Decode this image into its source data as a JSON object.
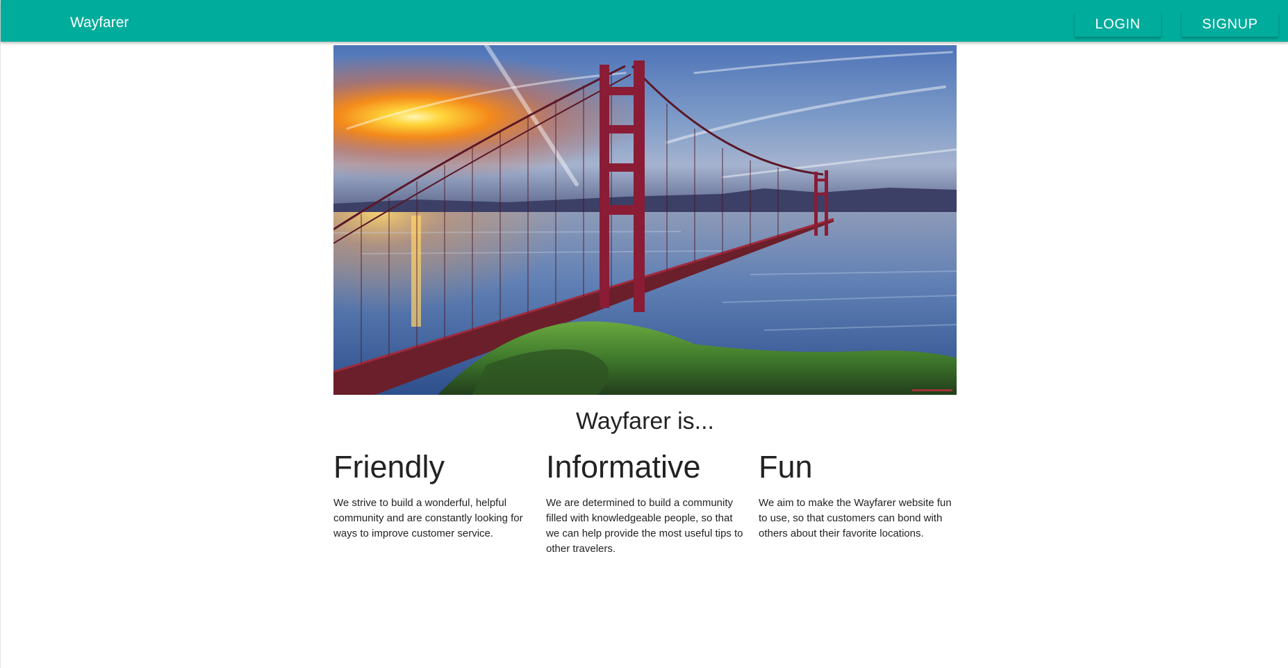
{
  "navbar": {
    "brand": "Wayfarer",
    "login_label": "LOGIN",
    "signup_label": "SIGNUP",
    "color": "#00ac9b"
  },
  "hero": {
    "image_subject": "Golden Gate Bridge at sunset"
  },
  "tagline": "Wayfarer is...",
  "features": [
    {
      "title": "Friendly",
      "text": "We strive to build a wonderful, helpful community and are constantly looking for ways to improve customer service."
    },
    {
      "title": "Informative",
      "text": "We are determined to build a community filled with knowledgeable people, so that we can help provide the most useful tips to other travelers."
    },
    {
      "title": "Fun",
      "text": "We aim to make the Wayfarer website fun to use, so that customers can bond with others about their favorite locations."
    }
  ]
}
